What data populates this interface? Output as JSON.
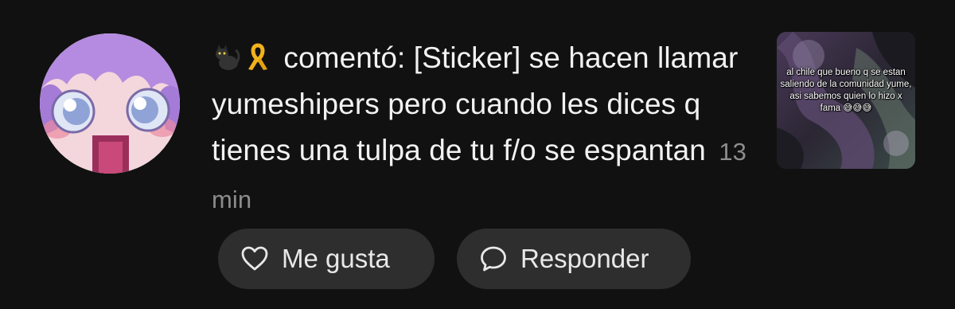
{
  "notification": {
    "author_emojis": [
      "black-cat",
      "awareness-ribbon"
    ],
    "action": "comentó:",
    "text": "[Sticker] se hacen llamar yumeshipers pero cuando les dices q tienes una tulpa de tu f/o se espantan",
    "time": "13 min"
  },
  "thumbnail": {
    "caption": "al chile que bueno q se estan saliendo de la comunidad yume, asi sabemos quien lo hizo x fama 😅😅😅"
  },
  "actions": {
    "like_label": "Me gusta",
    "reply_label": "Responder"
  },
  "colors": {
    "background": "#111111",
    "pill": "#2e2e2e",
    "text": "#f2f2f2",
    "muted": "#8c8c8c"
  }
}
